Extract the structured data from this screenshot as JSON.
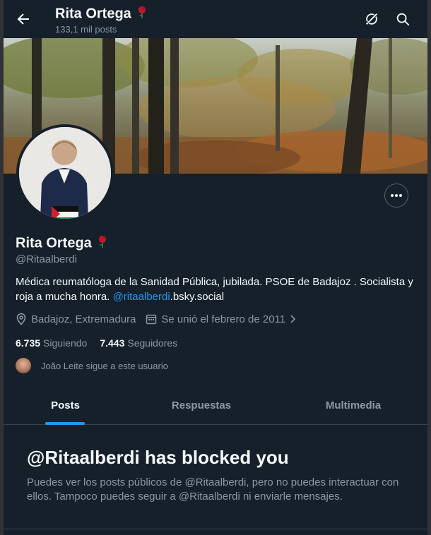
{
  "header": {
    "back_icon": "arrow-left-icon",
    "title": "Rita Ortega",
    "post_count": "133,1 mil posts",
    "grok_icon": "grok-icon",
    "search_icon": "search-icon"
  },
  "profile": {
    "name": "Rita Ortega",
    "handle": "@Ritaalberdi",
    "bio_text": "Médica reumatóloga de la Sanidad Pública, jubilada. PSOE de Badajoz . Socialista y roja a mucha honra. ",
    "bio_link": "@ritaalberdi",
    "bio_suffix": ".bsky.social",
    "location": "Badajoz, Extremadura",
    "joined": "Se unió el febrero de 2011",
    "following_count": "6.735",
    "following_label": "Siguiendo",
    "followers_count": "7.443",
    "followers_label": "Seguidores",
    "followed_by": "João Leite sigue a este usuario"
  },
  "tabs": [
    {
      "label": "Posts",
      "active": true
    },
    {
      "label": "Respuestas",
      "active": false
    },
    {
      "label": "Multimedia",
      "active": false
    }
  ],
  "blocked": {
    "title": "@Ritaalberdi has blocked you",
    "text": "Puedes ver los posts públicos de @Ritaalberdi, pero no puedes interactuar con ellos. Tampoco puedes seguir a @Ritaalberdi ni enviarle mensajes."
  },
  "colors": {
    "background": "#15202b",
    "accent": "#1d9bf0",
    "secondary_text": "#8b98a5"
  }
}
